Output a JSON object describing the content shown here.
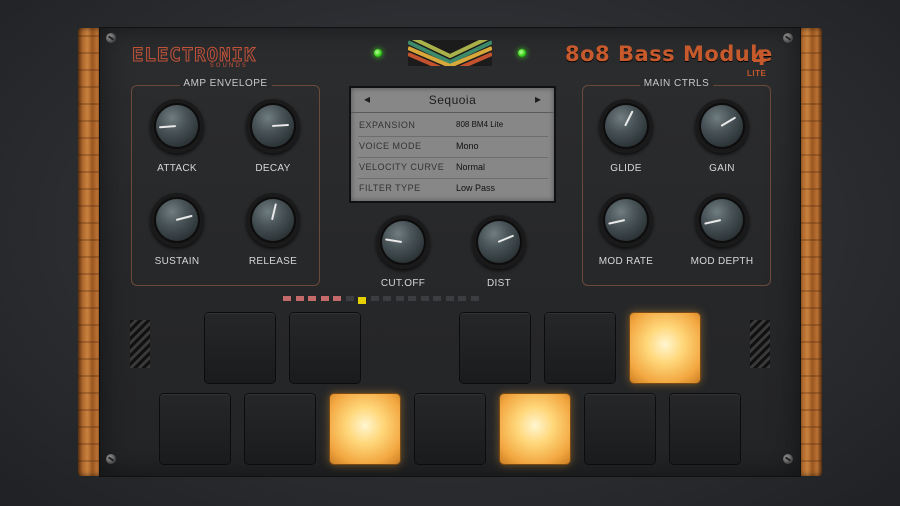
{
  "brand": {
    "logo": "ELECTRONIK",
    "logo_sub": "SOUNDS"
  },
  "header": {
    "title": "8o8 Bass Module",
    "title_number": "4",
    "subtitle": "LITE"
  },
  "amp_envelope": {
    "label": "AMP ENVELOPE",
    "knobs": [
      {
        "label": "ATTACK",
        "value": 0.15
      },
      {
        "label": "DECAY",
        "value": 0.82
      },
      {
        "label": "SUSTAIN",
        "value": 0.78
      },
      {
        "label": "RELEASE",
        "value": 0.55
      }
    ]
  },
  "display": {
    "preset": "Sequoia",
    "prev_icon": "◂",
    "next_icon": "▸",
    "rows": [
      {
        "key": "EXPANSION",
        "value": "808 BM4 Lite"
      },
      {
        "key": "VOICE MODE",
        "value": "Mono"
      },
      {
        "key": "VELOCITY CURVE",
        "value": "Normal"
      },
      {
        "key": "FILTER TYPE",
        "value": "Low Pass"
      }
    ]
  },
  "filter": {
    "knobs": [
      {
        "label": "CUT.OFF",
        "value": 0.2
      },
      {
        "label": "DIST",
        "value": 0.75
      }
    ]
  },
  "main_ctrls": {
    "label": "MAIN CTRLS",
    "knobs": [
      {
        "label": "GLIDE",
        "value": 0.6
      },
      {
        "label": "GAIN",
        "value": 0.72
      },
      {
        "label": "MOD RATE",
        "value": 0.12
      },
      {
        "label": "MOD DEPTH",
        "value": 0.12
      }
    ]
  },
  "sequencer": {
    "steps": 16,
    "highlighted_steps": [
      1,
      2,
      3,
      4,
      5
    ],
    "current_step": 7,
    "highlight_color": "#c46a6a",
    "current_color": "#e8d000"
  },
  "pads": {
    "top_row": [
      {
        "active": false
      },
      {
        "active": false
      },
      {
        "active": false
      },
      {
        "active": false
      },
      {
        "active": true
      }
    ],
    "bottom_row": [
      {
        "active": false
      },
      {
        "active": false
      },
      {
        "active": true
      },
      {
        "active": false
      },
      {
        "active": true
      },
      {
        "active": false
      },
      {
        "active": false
      }
    ]
  },
  "colors": {
    "accent": "#c65a2c",
    "led": "#36d11b",
    "pad_on": "#ffd77a"
  }
}
